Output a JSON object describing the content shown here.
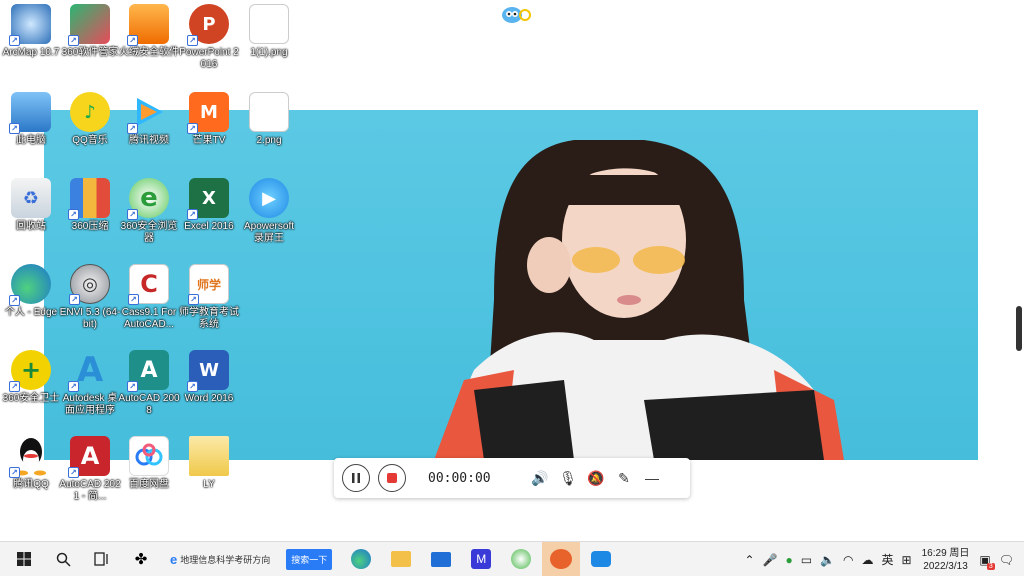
{
  "desktop": {
    "icons": [
      {
        "label": "ArcMap 10.7"
      },
      {
        "label": "360软件管家"
      },
      {
        "label": "火绒安全软件"
      },
      {
        "label": "PowerPoint 2016"
      },
      {
        "label": "1(1).png"
      },
      {
        "label": "此电脑"
      },
      {
        "label": "QQ音乐"
      },
      {
        "label": "腾讯视频"
      },
      {
        "label": "芒果TV"
      },
      {
        "label": "2.png"
      },
      {
        "label": "回收站"
      },
      {
        "label": "360压缩"
      },
      {
        "label": "360安全浏览器"
      },
      {
        "label": "Excel 2016"
      },
      {
        "label": "Apowersoft 录屏王"
      },
      {
        "label": "个人 - Edge"
      },
      {
        "label": "ENVI 5.3 (64-bit)"
      },
      {
        "label": "Cass9.1 For AutoCAD..."
      },
      {
        "label": "师学教育考试系统"
      },
      {
        "label": "360安全卫士"
      },
      {
        "label": "Autodesk 桌面应用程序"
      },
      {
        "label": "AutoCAD 2008"
      },
      {
        "label": "Word 2016"
      },
      {
        "label": "腾讯QQ"
      },
      {
        "label": "AutoCAD 2021 - 简..."
      },
      {
        "label": "百度网盘"
      },
      {
        "label": "LY"
      }
    ]
  },
  "recorder": {
    "time": "00:00:00"
  },
  "taskbar": {
    "search_text": "地理信息科学考研方向",
    "search_button": "搜索一下",
    "ime_label": "英",
    "clock_time": "16:29 周日",
    "clock_date": "2022/3/13",
    "notification_count": "3"
  },
  "colors": {
    "wallpaper_bg": "#4fc3e0",
    "taskbar_bg": "#f3f3f3",
    "search_button": "#2a7cf6",
    "record_stop": "#e53935"
  }
}
